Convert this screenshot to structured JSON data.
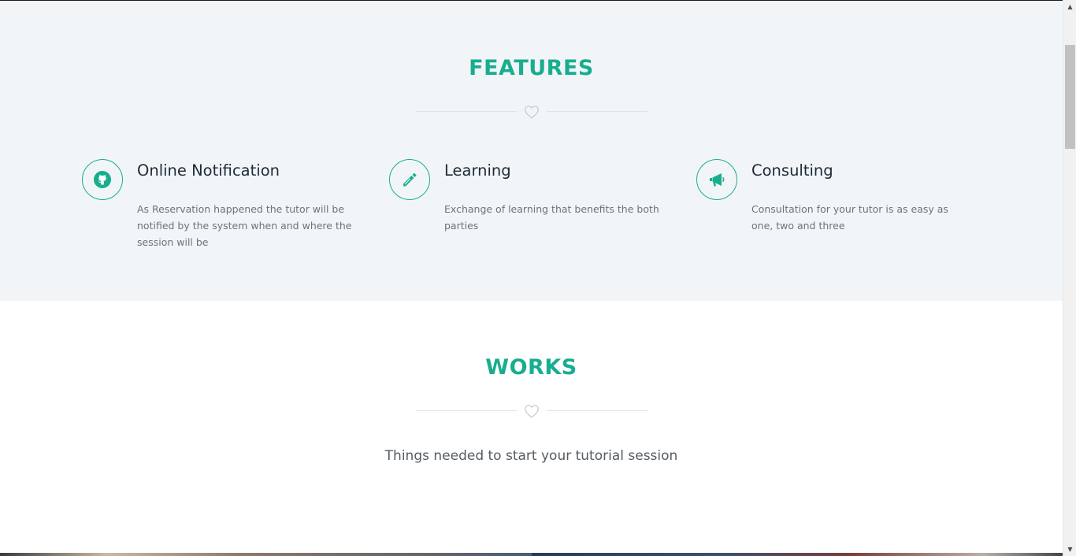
{
  "colors": {
    "accent": "#17ae8f",
    "features_bg": "#f2f5f8",
    "heading_text": "#1d2b36",
    "body_text": "#6b737a",
    "divider": "#dfe4e8"
  },
  "features": {
    "title": "FEATURES",
    "divider_icon": "heart-outline-icon",
    "items": [
      {
        "icon": "github-icon",
        "title": "Online Notification",
        "description": "As Reservation happened the tutor will be notified by the system when and where the session will be"
      },
      {
        "icon": "pencil-icon",
        "title": "Learning",
        "description": "Exchange of learning that benefits the both parties"
      },
      {
        "icon": "megaphone-icon",
        "title": "Consulting",
        "description": "Consultation for your tutor is as easy as one, two and three"
      }
    ]
  },
  "works": {
    "title": "WORKS",
    "divider_icon": "heart-outline-icon",
    "subtitle": "Things needed to start your tutorial session"
  },
  "scrollbar": {
    "up_glyph": "▲",
    "down_glyph": "▼"
  }
}
